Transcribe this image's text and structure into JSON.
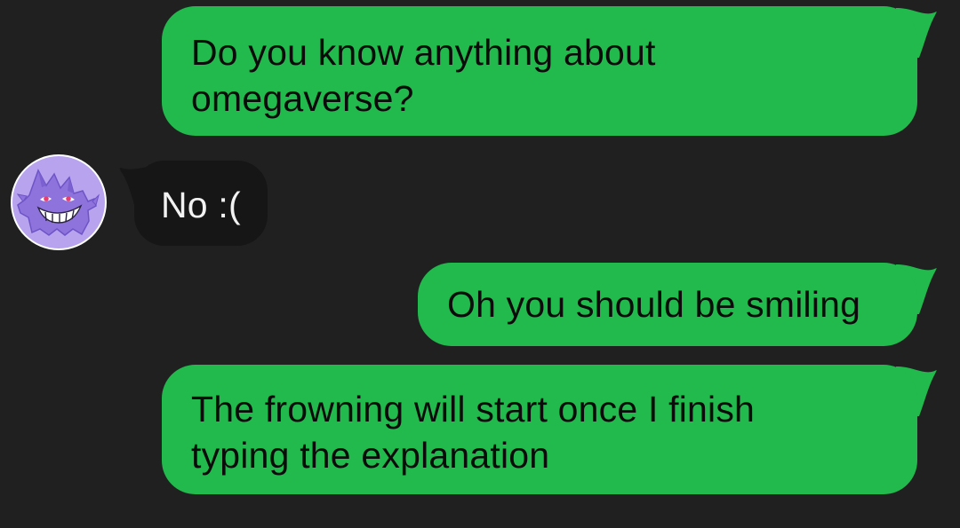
{
  "colors": {
    "background": "#202020",
    "outgoing_bubble": "#22b94d",
    "incoming_bubble": "#161616",
    "outgoing_text": "#0b0b0b",
    "incoming_text": "#f2f2f2",
    "avatar_fill": "#b7a3ee"
  },
  "contact": {
    "avatar_icon": "purple-ghost-avatar-icon"
  },
  "messages": [
    {
      "direction": "outgoing",
      "lines": [
        "Do you know anything about",
        "omegaverse?"
      ]
    },
    {
      "direction": "incoming",
      "lines": [
        "No :("
      ]
    },
    {
      "direction": "outgoing",
      "lines": [
        "Oh you should be smiling"
      ]
    },
    {
      "direction": "outgoing",
      "lines": [
        "The frowning will start once I finish",
        "typing the explanation"
      ]
    }
  ]
}
